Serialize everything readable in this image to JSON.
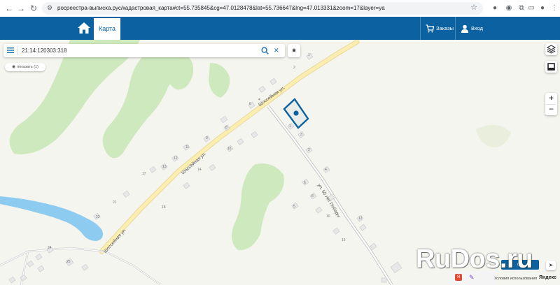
{
  "browser": {
    "url": "росреестра-выписка.рус/кадастровая_карта#ct=55.735845&cg=47.0128478&lat=55.736647&lng=47.013331&zoom=17&layer=ya",
    "icons": [
      "back-icon",
      "forward-icon",
      "reload-icon",
      "site-settings-icon",
      "bookmark-star-icon",
      "extension-icon",
      "puzzle-icon",
      "sidebar-icon",
      "profile-icon",
      "menu-dots-icon"
    ]
  },
  "header": {
    "tab_map": "Карта",
    "orders": "Заказы",
    "login": "Вход",
    "brand_color": "#0c62a0"
  },
  "search": {
    "value": "21:14:120303:318"
  },
  "show_button": {
    "label": "показать (1)"
  },
  "map": {
    "streets": [
      {
        "name": "Шоссейная ул."
      },
      {
        "name": "Шоссейная ул."
      },
      {
        "name": "Шоссейная ул."
      },
      {
        "name": "ул. 50 лет Победы"
      }
    ],
    "house_numbers": [
      "1",
      "2",
      "4",
      "6",
      "8",
      "9",
      "11",
      "12",
      "13",
      "14",
      "16",
      "17",
      "18",
      "21",
      "23",
      "24",
      "25",
      "1",
      "2",
      "3",
      "4",
      "5",
      "6",
      "8",
      "10",
      "12",
      "15"
    ],
    "water_color": "#8ecbf0",
    "forest_color": "#cfe9bf",
    "road_color": "#f9e8a0"
  },
  "footer": {
    "terms": "Условия использования",
    "yandex": "Яндекс"
  },
  "watermark": {
    "text": "RuDos.ru",
    "button": "ща"
  }
}
